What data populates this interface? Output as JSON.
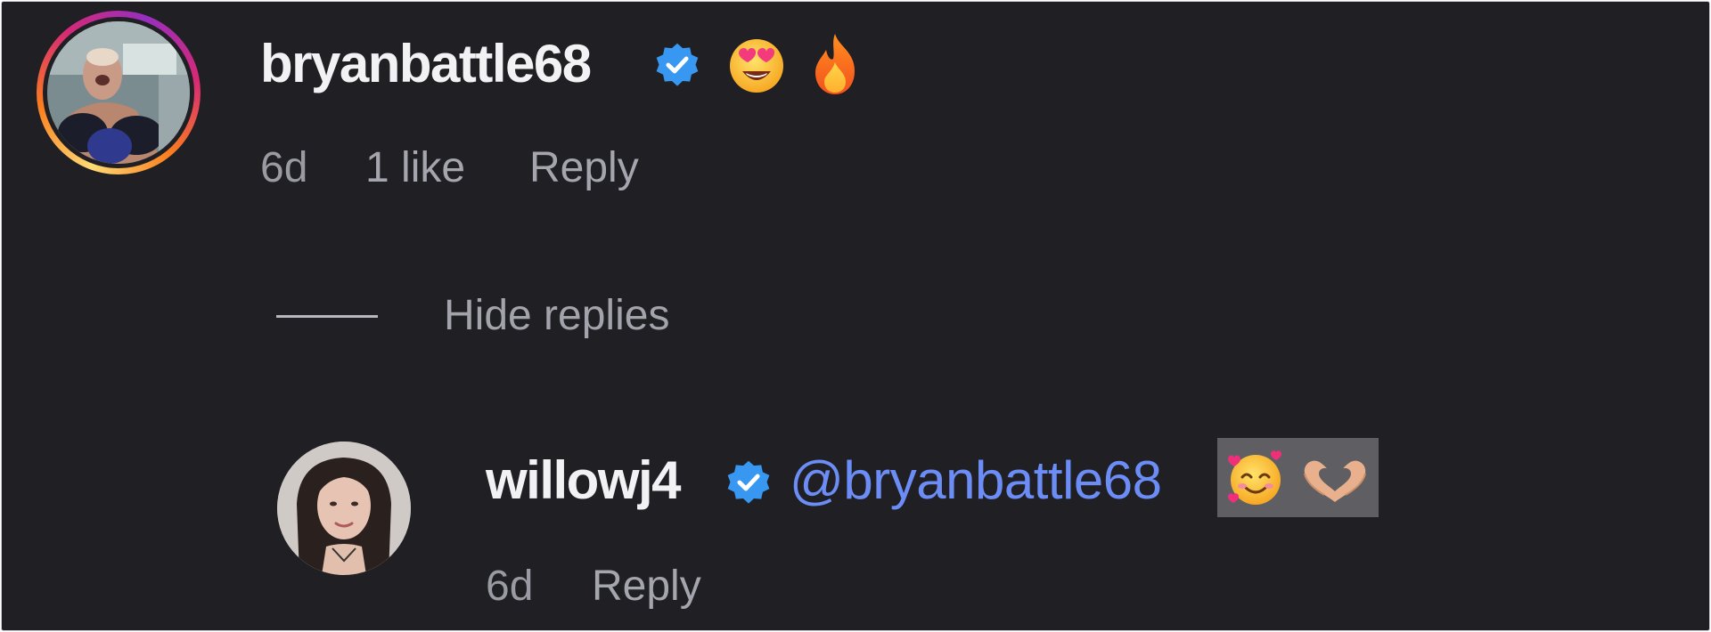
{
  "comment": {
    "username": "bryanbattle68",
    "verified": true,
    "emojis": [
      "star-struck-emoji",
      "fire-emoji"
    ],
    "time": "6d",
    "likes": "1 like",
    "reply_label": "Reply"
  },
  "replies_toggle": {
    "label": "Hide replies"
  },
  "reply": {
    "username": "willowj4",
    "verified": true,
    "mention": "@bryanbattle68",
    "emojis": [
      "smiling-face-with-hearts-emoji",
      "heart-hands-emoji"
    ],
    "time": "6d",
    "reply_label": "Reply"
  },
  "colors": {
    "background": "#1f1f24",
    "username": "#f2f2f4",
    "meta": "#9a9aa2",
    "mention": "#6b8df5",
    "verified": "#3897f0"
  }
}
